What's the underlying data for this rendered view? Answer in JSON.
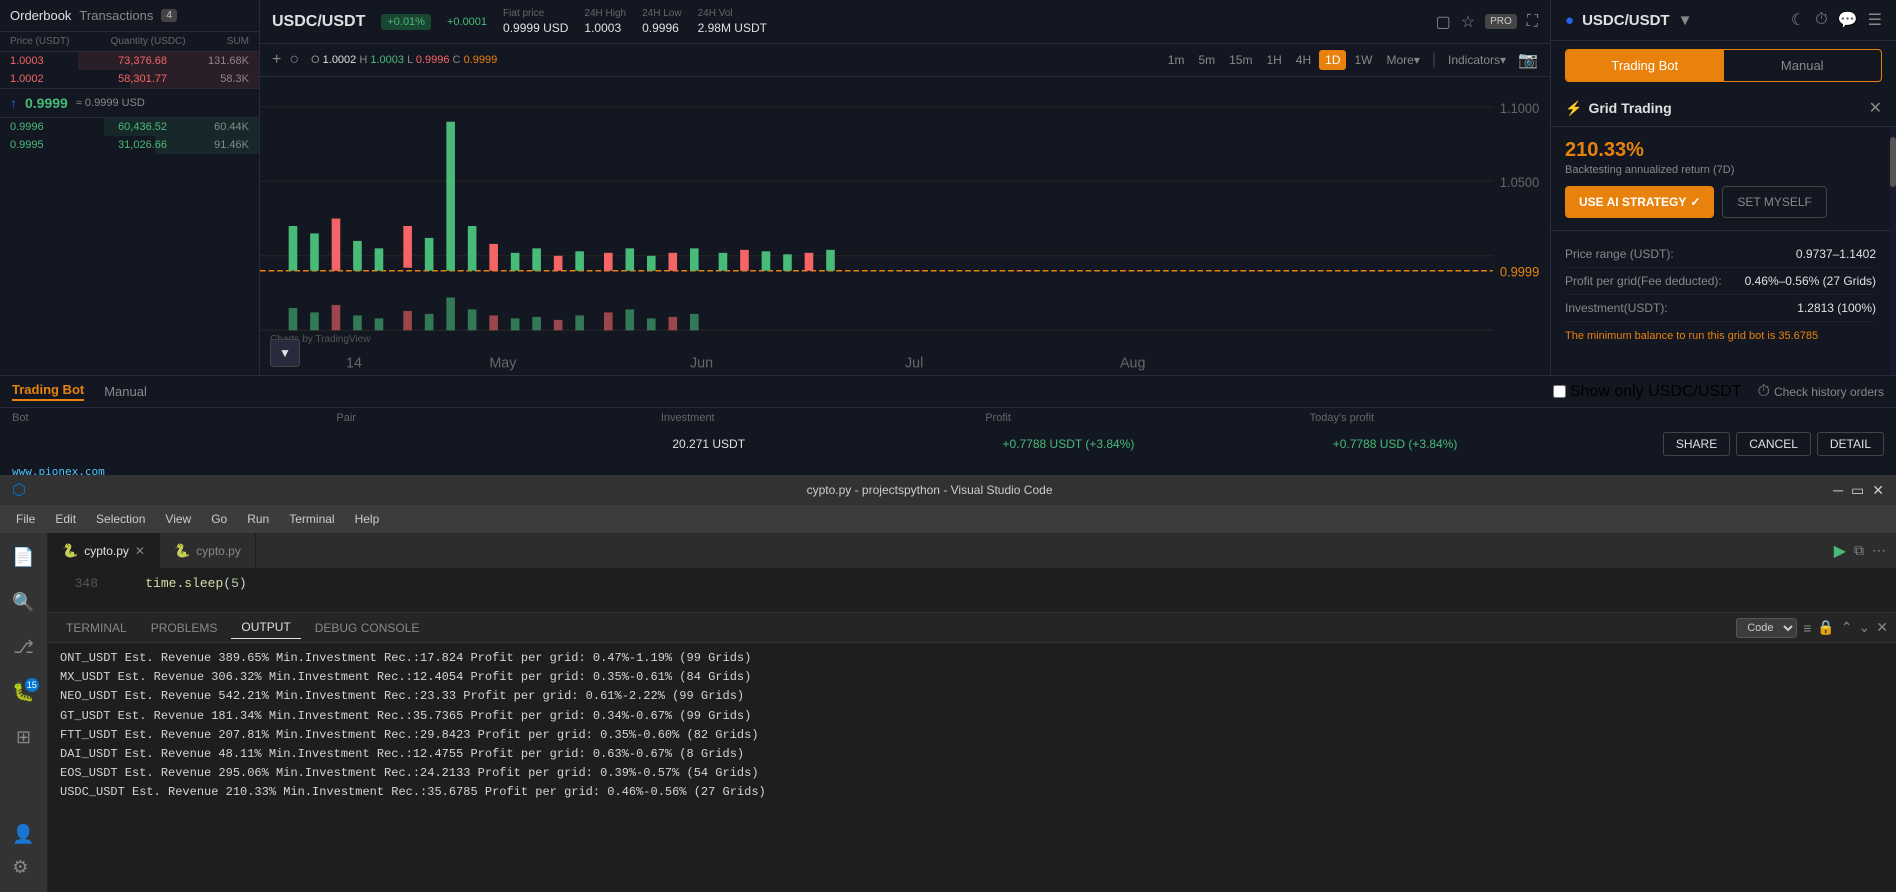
{
  "trading": {
    "pair": "USDC/USDT",
    "price": "0.9999",
    "change_pct": "+0.01%",
    "change_abs": "+0.0001",
    "fiat_label": "Fiat price",
    "fiat_value": "0.9999 USD",
    "high_label": "24H High",
    "high_value": "1.0003",
    "low_label": "24H Low",
    "low_value": "0.9996",
    "vol_label": "24H Vol",
    "vol_value": "2.98M USDT"
  },
  "orderbook": {
    "title": "Orderbook",
    "transactions_tab": "Transactions",
    "badge": "4",
    "columns": [
      "Price (USDT)",
      "Quantity (USDC)",
      "SUM"
    ],
    "asks": [
      {
        "price": "1.0003",
        "qty": "73,376.68",
        "sum": "131.68K",
        "bar": 70
      },
      {
        "price": "1.0002",
        "qty": "58,301.77",
        "sum": "58.3K",
        "bar": 50
      }
    ],
    "mid_price": "≈ 0.9999 USD",
    "mid_price_main": "0.9999",
    "bids": [
      {
        "price": "0.9996",
        "qty": "60,436.52",
        "sum": "60.44K",
        "bar": 60
      },
      {
        "price": "0.9995",
        "qty": "31,026.66",
        "sum": "91.46K",
        "bar": 40
      }
    ]
  },
  "chart": {
    "timeframes": [
      "1m",
      "5m",
      "15m",
      "1H",
      "4H",
      "1D",
      "1W"
    ],
    "active_tf": "1D",
    "more": "More",
    "indicators": "Indicators",
    "ohlc": {
      "o": "1.0002",
      "h": "1.0003",
      "l": "0.9996",
      "c": "0.9999"
    },
    "x_labels": [
      "14",
      "May",
      "Jun",
      "Jul",
      "Aug"
    ],
    "price_line": "0.9999",
    "y_labels": [
      "1.1000",
      "1.0500",
      "0.9999"
    ]
  },
  "right_panel": {
    "pair": "USDC/USDT",
    "tab_bot": "Trading Bot",
    "tab_manual": "Manual",
    "grid_title": "Grid Trading",
    "return_pct": "210.33%",
    "return_label": "Backtesting annualized return (7D)",
    "btn_ai": "USE AI STRATEGY",
    "btn_set": "SET MYSELF",
    "details": {
      "price_range_label": "Price range (USDT):",
      "price_range_value": "0.9737–1.1402",
      "profit_label": "Profit per grid(Fee deducted):",
      "profit_value": "0.46%–0.56% (27 Grids)",
      "investment_label": "Investment(USDT):",
      "investment_value": "1.2813 (100%)"
    },
    "min_balance": "The minimum balance to run this grid bot is 35.6785"
  },
  "trading_bot_list": {
    "tab_bot": "Trading Bot",
    "tab_manual": "Manual",
    "columns": [
      "Bot",
      "Pair",
      "Investment",
      "Profit",
      "Today's profit"
    ],
    "filter_label": "Show only USDC/USDT",
    "history_label": "Check history orders",
    "row": {
      "bot": "",
      "pair": "",
      "investment": "20.271 USDT",
      "profit": "+0.7788 USDT (+3.84%)",
      "todays_profit": "+0.7788 USD (+3.84%)"
    },
    "btn_share": "SHARE",
    "btn_cancel": "CANCEL",
    "btn_detail": "DETAIL",
    "url": "www.pionex.com"
  },
  "vscode": {
    "title": "cypto.py - projectspython - Visual Studio Code",
    "tabs": [
      {
        "name": "cypto.py",
        "active": true
      },
      {
        "name": "cypto.py",
        "active": false
      }
    ],
    "menu_items": [
      "File",
      "Edit",
      "Selection",
      "View",
      "Go",
      "Run",
      "Terminal",
      "Help"
    ],
    "editor_line": {
      "num": "348",
      "content": "    time.sleep(5)"
    },
    "terminal": {
      "tabs": [
        "TERMINAL",
        "PROBLEMS",
        "OUTPUT",
        "DEBUG CONSOLE"
      ],
      "active_tab": "OUTPUT",
      "select_label": "Code",
      "output_lines": [
        "ONT_USDT Est. Revenue 389.65% Min.Investment Rec.:17.824 Profit per grid: 0.47%-1.19% (99 Grids)",
        "MX_USDT Est. Revenue 306.32% Min.Investment Rec.:12.4054 Profit per grid: 0.35%-0.61% (84 Grids)",
        "NEO_USDT Est. Revenue 542.21% Min.Investment Rec.:23.33 Profit per grid: 0.61%-2.22% (99 Grids)",
        "GT_USDT Est. Revenue 181.34% Min.Investment Rec.:35.7365 Profit per grid: 0.34%-0.67% (99 Grids)",
        "FTT_USDT Est. Revenue 207.81% Min.Investment Rec.:29.8423 Profit per grid: 0.35%-0.60% (82 Grids)",
        "DAI_USDT Est. Revenue 48.11% Min.Investment Rec.:12.4755 Profit per grid: 0.63%-0.67% (8 Grids)",
        "EOS_USDT Est. Revenue 295.06% Min.Investment Rec.:24.2133 Profit per grid: 0.39%-0.57% (54 Grids)",
        "USDC_USDT Est. Revenue 210.33% Min.Investment Rec.:35.6785 Profit per grid: 0.46%-0.56% (27 Grids)"
      ]
    }
  }
}
